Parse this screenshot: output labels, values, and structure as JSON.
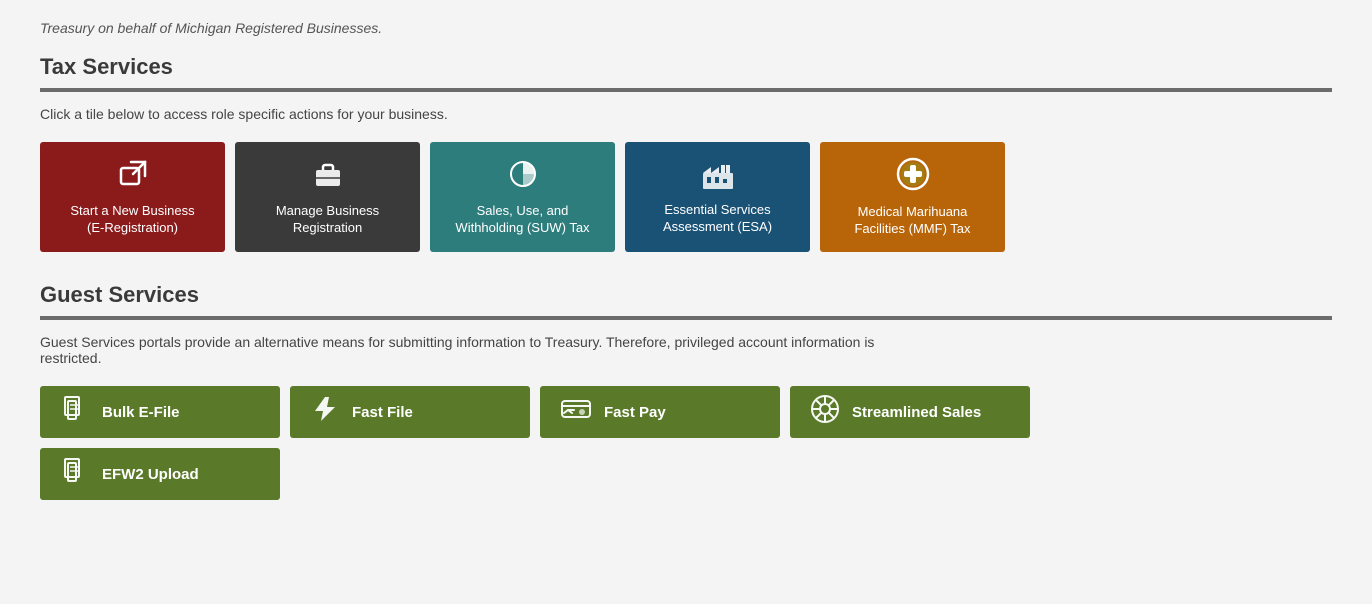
{
  "page": {
    "top_text": "Treasury on behalf of Michigan Registered Businesses.",
    "tax_services": {
      "title": "Tax Services",
      "description": "Click a tile below to access role specific actions for your business.",
      "tiles": [
        {
          "id": "start-new-business",
          "label": "Start a New Business\n(E-Registration)",
          "label_line1": "Start a New Business",
          "label_line2": "(E-Registration)",
          "color_class": "tile-red",
          "icon": "↗"
        },
        {
          "id": "manage-business-registration",
          "label": "Manage Business Registration",
          "label_line1": "Manage Business",
          "label_line2": "Registration",
          "color_class": "tile-dark",
          "icon": "💼"
        },
        {
          "id": "sales-use-withholding",
          "label": "Sales, Use, and Withholding (SUW) Tax",
          "label_line1": "Sales, Use, and",
          "label_line2": "Withholding (SUW) Tax",
          "color_class": "tile-teal",
          "icon": "📊"
        },
        {
          "id": "essential-services",
          "label": "Essential Services Assessment (ESA)",
          "label_line1": "Essential Services",
          "label_line2": "Assessment (ESA)",
          "color_class": "tile-navy",
          "icon": "🏭"
        },
        {
          "id": "medical-marihuana",
          "label": "Medical Marihuana Facilities (MMF) Tax",
          "label_line1": "Medical Marihuana",
          "label_line2": "Facilities (MMF) Tax",
          "color_class": "tile-orange",
          "icon": "➕"
        }
      ]
    },
    "guest_services": {
      "title": "Guest Services",
      "description": "Guest Services portals provide an alternative means for submitting information to Treasury. Therefore, privileged account information is restricted.",
      "buttons_row1": [
        {
          "id": "bulk-e-file",
          "label": "Bulk E-File",
          "icon": "📄"
        },
        {
          "id": "fast-file",
          "label": "Fast File",
          "icon": "⚡"
        },
        {
          "id": "fast-pay",
          "label": "Fast Pay",
          "icon": "💳"
        },
        {
          "id": "streamlined-sales",
          "label": "Streamlined Sales",
          "icon": "⚙"
        }
      ],
      "buttons_row2": [
        {
          "id": "efw2-upload",
          "label": "EFW2 Upload",
          "icon": "📄"
        }
      ]
    }
  }
}
